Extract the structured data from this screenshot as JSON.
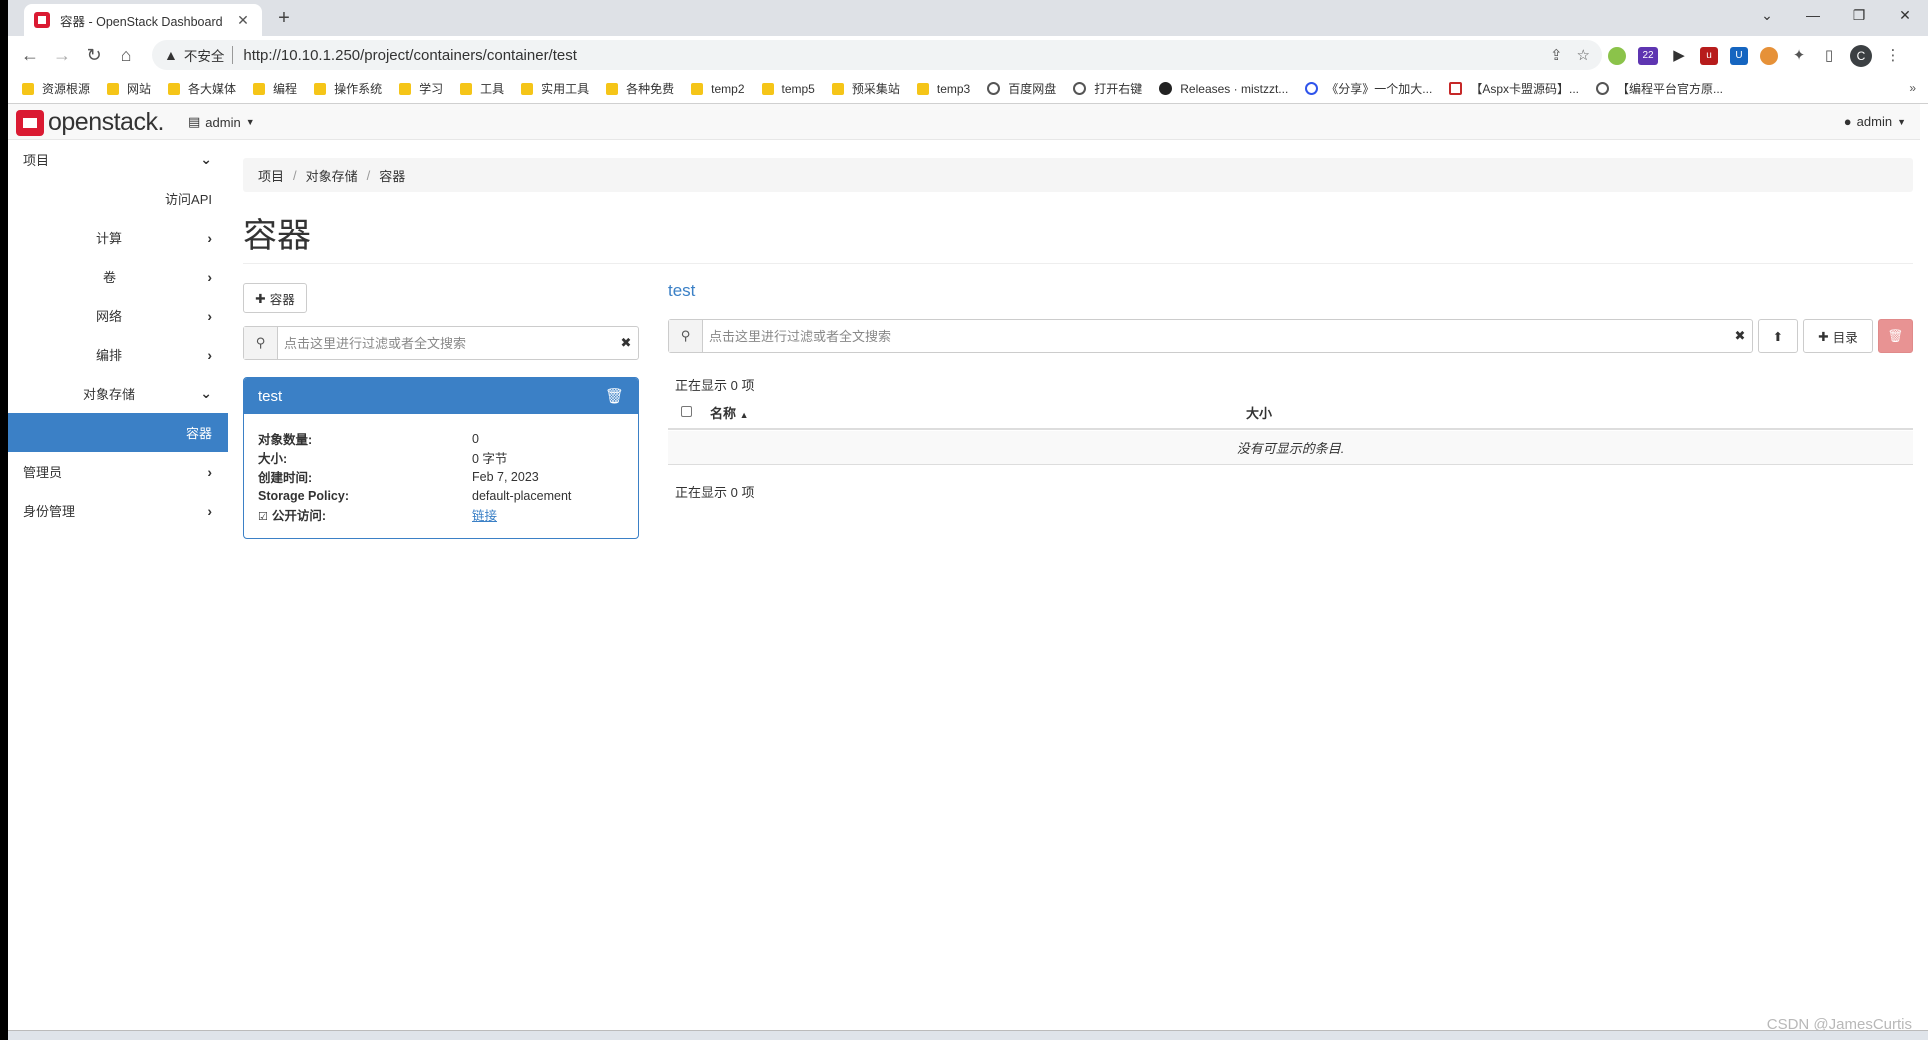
{
  "browser": {
    "tab_title": "容器 - OpenStack Dashboard",
    "tab_close": "✕",
    "new_tab": "+",
    "insecure_label": "不安全",
    "url": "http://10.10.1.250/project/containers/container/test",
    "window_controls": [
      "⌄",
      "—",
      "❐",
      "✕"
    ],
    "profile_initial": "C",
    "bookmarks": [
      "资源根源",
      "网站",
      "各大媒体",
      "编程",
      "操作系统",
      "学习",
      "工具",
      "实用工具",
      "各种免费",
      "temp2",
      "temp5",
      "预采集站",
      "temp3",
      "百度网盘",
      "打开右键",
      "Releases · mistzzt...",
      "《分享》一个加大...",
      "【Aspx卡盟源码】...",
      "【编程平台官方原..."
    ],
    "bookmarks_more": "»",
    "extension_badge": "22"
  },
  "header": {
    "logo": "openstack.",
    "project_menu": "admin",
    "user_menu": "admin"
  },
  "sidebar": {
    "items": [
      {
        "label": "项目",
        "arrow": "⌄"
      },
      {
        "label": "访问API",
        "arrow": ""
      },
      {
        "label": "计算",
        "arrow": "›"
      },
      {
        "label": "卷",
        "arrow": "›"
      },
      {
        "label": "网络",
        "arrow": "›"
      },
      {
        "label": "编排",
        "arrow": "›"
      },
      {
        "label": "对象存储",
        "arrow": "⌄"
      },
      {
        "label": "容器",
        "arrow": ""
      },
      {
        "label": "管理员",
        "arrow": "›"
      },
      {
        "label": "身份管理",
        "arrow": "›"
      }
    ]
  },
  "breadcrumb": [
    "项目",
    "对象存储",
    "容器"
  ],
  "page_title": "容器",
  "containers": {
    "add_button": "容器",
    "search_placeholder": "点击这里进行过滤或者全文搜索",
    "card": {
      "name": "test",
      "fields": [
        {
          "key": "对象数量:",
          "value": "0"
        },
        {
          "key": "大小:",
          "value": "0 字节"
        },
        {
          "key": "创建时间:",
          "value": "Feb 7, 2023"
        },
        {
          "key": "Storage Policy:",
          "value": "default-placement"
        },
        {
          "key": "公开访问:",
          "value": "链接"
        }
      ]
    }
  },
  "objects": {
    "title": "test",
    "search_placeholder": "点击这里进行过滤或者全文搜索",
    "folder_button": "目录",
    "showing_top": "正在显示 0 项",
    "showing_bottom": "正在显示 0 项",
    "columns": [
      "名称",
      "大小"
    ],
    "empty_message": "没有可显示的条目."
  },
  "watermark": "CSDN @JamesCurtis"
}
